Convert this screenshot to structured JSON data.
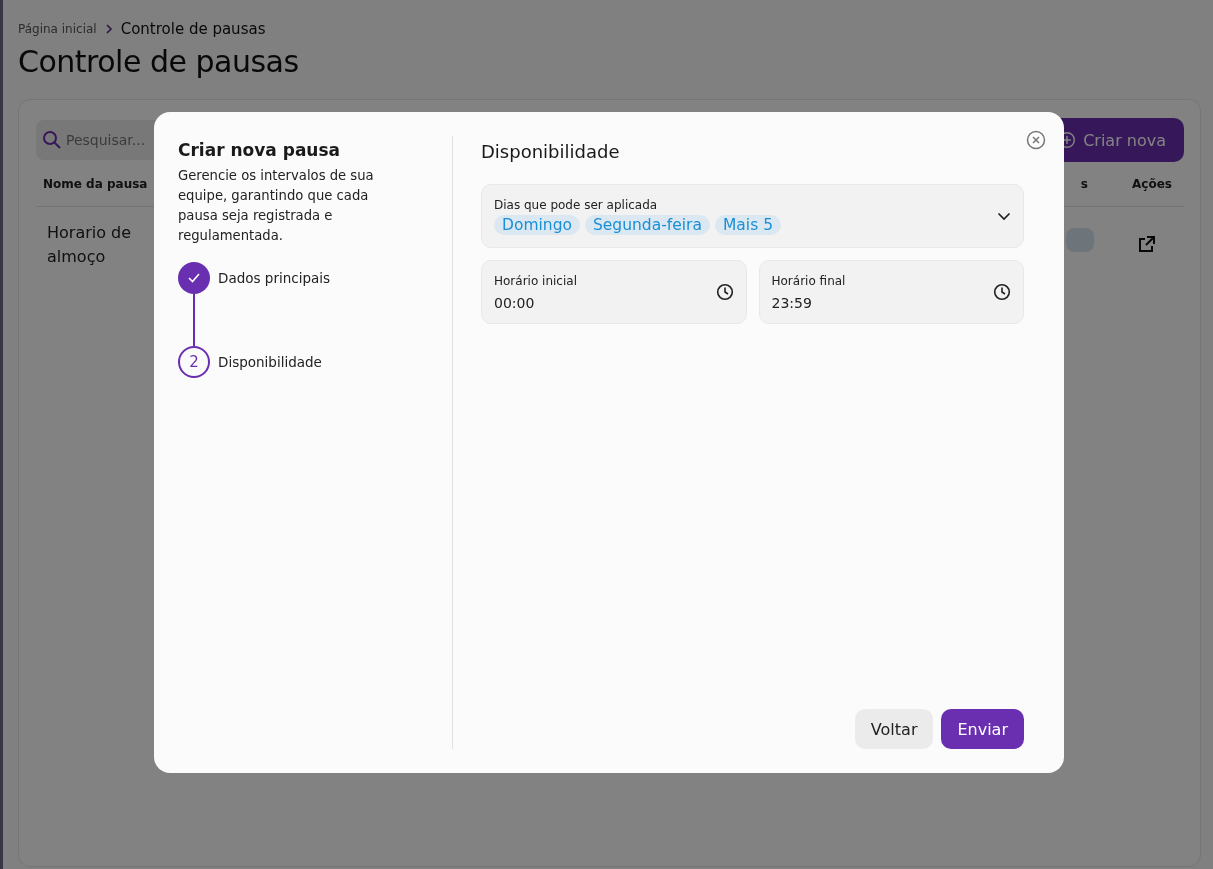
{
  "breadcrumb": [
    {
      "label": "Página inicial",
      "selected": false
    },
    {
      "label": "Controle de pausas",
      "selected": true
    }
  ],
  "page_title": "Controle de pausas",
  "search": {
    "placeholder": "Pesquisar..."
  },
  "create_button": "Criar nova",
  "table": {
    "columns": [
      "Nome da pausa",
      "s",
      "Ações"
    ],
    "rows": [
      {
        "name": "Horario de almoço"
      }
    ]
  },
  "modal": {
    "title": "Criar nova pausa",
    "description": "Gerencie os intervalos de sua equipe, garantindo que cada pausa seja registrada e regulamentada.",
    "steps": [
      {
        "label": "Dados principais",
        "completed": true
      },
      {
        "label": "Disponibilidade",
        "number": "2",
        "completed": false
      }
    ],
    "section_title": "Disponibilidade",
    "days_field": {
      "label": "Dias que pode ser aplicada",
      "chips": [
        "Domingo",
        "Segunda-feira",
        "Mais 5"
      ]
    },
    "time_fields": [
      {
        "label": "Horário inicial",
        "value": "00:00"
      },
      {
        "label": "Horário final",
        "value": "23:59"
      }
    ],
    "buttons": [
      {
        "label": "Voltar",
        "kind": "secondary"
      },
      {
        "label": "Enviar",
        "kind": "primary"
      }
    ]
  }
}
